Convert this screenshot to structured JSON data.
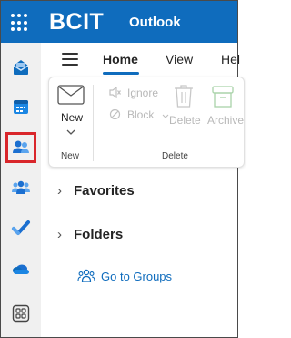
{
  "header": {
    "brand": "BCIT",
    "app_name": "Outlook"
  },
  "tabs": [
    {
      "label": "Home",
      "active": true
    },
    {
      "label": "View",
      "active": false
    },
    {
      "label": "Hel",
      "active": false
    }
  ],
  "ribbon": {
    "new_label": "New",
    "new_group_label": "New",
    "ignore_label": "Ignore",
    "block_label": "Block",
    "delete_label": "Delete",
    "archive_label": "Archive",
    "delete_group_label": "Delete"
  },
  "folders": {
    "favorites_label": "Favorites",
    "folders_label": "Folders",
    "groups_link": "Go to Groups"
  },
  "rail": {
    "items": [
      "mail-icon",
      "calendar-icon",
      "people-icon",
      "groups-icon",
      "todo-icon",
      "onedrive-icon",
      "apps-icon"
    ],
    "selected": "people-icon"
  },
  "colors": {
    "brand_blue": "#0f6cbd",
    "selection_outline": "#d9262b"
  }
}
